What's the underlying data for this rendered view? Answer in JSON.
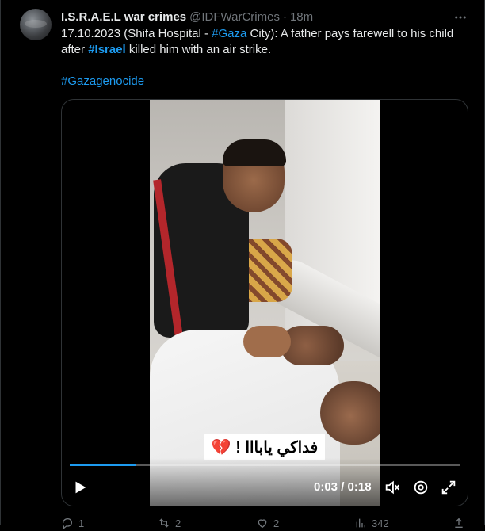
{
  "tweet": {
    "display_name": "I.S.R.A.E.L war crimes",
    "handle": "@IDFWarCrimes",
    "separator": "·",
    "time": "18m",
    "text_part1": "17.10.2023 (Shifa Hospital - ",
    "hashtag_gaza": "#Gaza",
    "text_part2": " City): A father pays farewell to his child after ",
    "hashtag_israel": "#Israel",
    "text_part3": " killed him with an air strike.",
    "hashtag_genocide": "#Gazagenocide"
  },
  "video": {
    "caption": "فداكي يابااا ! 💔",
    "time_current": "0:03",
    "time_separator": " / ",
    "time_total": "0:18",
    "progress": 0.17
  },
  "actions": {
    "replies": "1",
    "reposts": "2",
    "likes": "2",
    "views": "342"
  },
  "colors": {
    "background": "#000000",
    "text": "#e7e9ea",
    "muted": "#71767b",
    "accent": "#1d9bf0"
  },
  "icons": [
    "more-icon",
    "play-icon",
    "volume-icon",
    "settings-icon",
    "fullscreen-icon",
    "reply-icon",
    "repost-icon",
    "like-icon",
    "views-icon",
    "share-icon"
  ]
}
